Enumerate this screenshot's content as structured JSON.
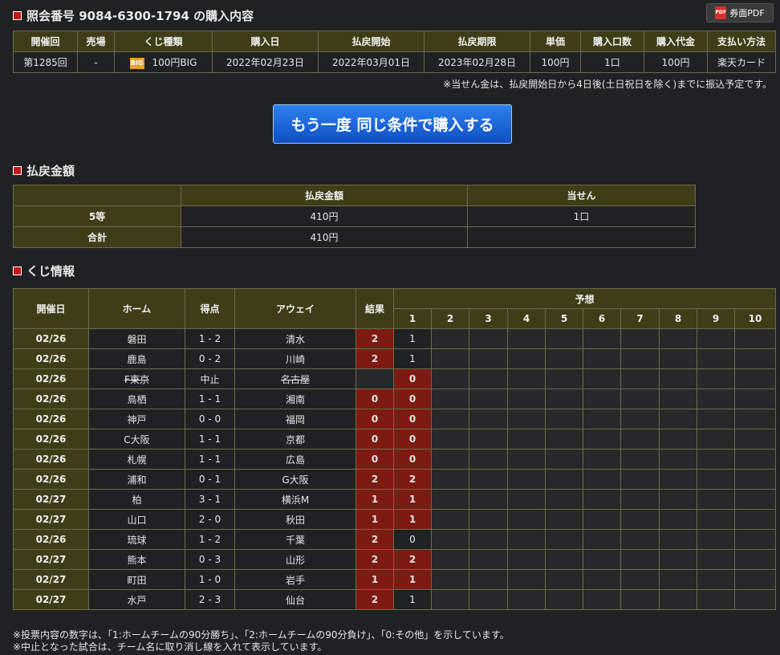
{
  "header": {
    "title": "照会番号 9084-6300-1794 の購入内容",
    "pdf_label": "券面PDF",
    "pdf_icon_text": "PDF"
  },
  "purchase": {
    "columns": [
      "開催回",
      "売場",
      "くじ種類",
      "購入日",
      "払戻開始",
      "払戻期限",
      "単価",
      "購入口数",
      "購入代金",
      "支払い方法"
    ],
    "row": [
      "第1285回",
      "-",
      "100円BIG",
      "2022年02月23日",
      "2022年03月01日",
      "2023年02月28日",
      "100円",
      "1口",
      "100円",
      "楽天カード"
    ],
    "lottery_icon_text": "BIG",
    "note": "※当せん金は、払戻開始日から4日後(土日祝日を除く)までに振込予定です。"
  },
  "rebuy_label": "もう一度 同じ条件で購入する",
  "payout": {
    "title": "払戻金額",
    "columns": [
      "",
      "払戻金額",
      "当せん"
    ],
    "rows": [
      [
        "5等",
        "410円",
        "1口"
      ],
      [
        "合計",
        "410円",
        ""
      ]
    ]
  },
  "lottery": {
    "title": "くじ情報",
    "columns": [
      "開催日",
      "ホーム",
      "得点",
      "アウェイ",
      "結果"
    ],
    "prediction_header": "予想",
    "prediction_cols": [
      "1",
      "2",
      "3",
      "4",
      "5",
      "6",
      "7",
      "8",
      "9",
      "10"
    ],
    "rows": [
      {
        "date": "02/26",
        "home": "磐田",
        "score": "1 - 2",
        "away": "清水",
        "result": "2",
        "pred": "1",
        "hit": false,
        "cancel": false
      },
      {
        "date": "02/26",
        "home": "鹿島",
        "score": "0 - 2",
        "away": "川崎",
        "result": "2",
        "pred": "1",
        "hit": false,
        "cancel": false
      },
      {
        "date": "02/26",
        "home": "F東京",
        "score": "中止",
        "away": "名古屋",
        "result": "",
        "pred": "0",
        "hit": true,
        "cancel": true
      },
      {
        "date": "02/26",
        "home": "鳥栖",
        "score": "1 - 1",
        "away": "湘南",
        "result": "0",
        "pred": "0",
        "hit": true,
        "cancel": false
      },
      {
        "date": "02/26",
        "home": "神戸",
        "score": "0 - 0",
        "away": "福岡",
        "result": "0",
        "pred": "0",
        "hit": true,
        "cancel": false
      },
      {
        "date": "02/26",
        "home": "C大阪",
        "score": "1 - 1",
        "away": "京都",
        "result": "0",
        "pred": "0",
        "hit": true,
        "cancel": false
      },
      {
        "date": "02/26",
        "home": "札幌",
        "score": "1 - 1",
        "away": "広島",
        "result": "0",
        "pred": "0",
        "hit": true,
        "cancel": false
      },
      {
        "date": "02/26",
        "home": "浦和",
        "score": "0 - 1",
        "away": "G大阪",
        "result": "2",
        "pred": "2",
        "hit": true,
        "cancel": false
      },
      {
        "date": "02/27",
        "home": "柏",
        "score": "3 - 1",
        "away": "横浜M",
        "result": "1",
        "pred": "1",
        "hit": true,
        "cancel": false
      },
      {
        "date": "02/27",
        "home": "山口",
        "score": "2 - 0",
        "away": "秋田",
        "result": "1",
        "pred": "1",
        "hit": true,
        "cancel": false
      },
      {
        "date": "02/26",
        "home": "琉球",
        "score": "1 - 2",
        "away": "千葉",
        "result": "2",
        "pred": "0",
        "hit": false,
        "cancel": false
      },
      {
        "date": "02/27",
        "home": "熊本",
        "score": "0 - 3",
        "away": "山形",
        "result": "2",
        "pred": "2",
        "hit": true,
        "cancel": false
      },
      {
        "date": "02/27",
        "home": "町田",
        "score": "1 - 0",
        "away": "岩手",
        "result": "1",
        "pred": "1",
        "hit": true,
        "cancel": false
      },
      {
        "date": "02/27",
        "home": "水戸",
        "score": "2 - 3",
        "away": "仙台",
        "result": "2",
        "pred": "1",
        "hit": false,
        "cancel": false
      }
    ]
  },
  "footnotes": [
    "※投票内容の数字は、「1:ホームチームの90分勝ち」、「2:ホームチームの90分負け」、「0:その他」を示しています。",
    "※中止となった試合は、チーム名に取り消し線を入れて表示しています。"
  ],
  "colors": {
    "header_bg": "#3e3d17",
    "hit_bg": "#7d1a12",
    "button": "#1d63d8",
    "marker": "#c8151b"
  }
}
